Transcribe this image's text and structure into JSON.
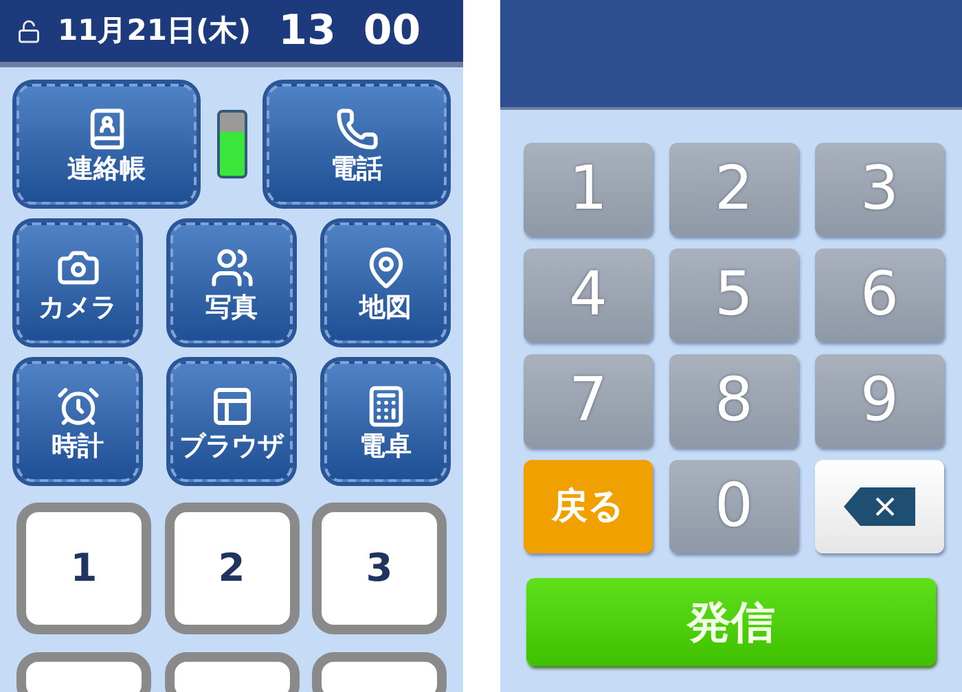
{
  "left_screen": {
    "status_bar": {
      "locked": false,
      "date": "11月21日(木)",
      "time_hours": "13",
      "time_minutes": "00"
    },
    "battery": {
      "level": 0.7
    },
    "apps": [
      {
        "label": "連絡帳"
      },
      {
        "label": "電話"
      },
      {
        "label": "カメラ"
      },
      {
        "label": "写真"
      },
      {
        "label": "地図"
      },
      {
        "label": "時計"
      },
      {
        "label": "ブラウザ"
      },
      {
        "label": "電卓"
      }
    ],
    "speed_dial": [
      "1",
      "2",
      "3"
    ]
  },
  "right_screen": {
    "keys": [
      {
        "kind": "digit",
        "label": "1"
      },
      {
        "kind": "digit",
        "label": "2"
      },
      {
        "kind": "digit",
        "label": "3"
      },
      {
        "kind": "digit",
        "label": "4"
      },
      {
        "kind": "digit",
        "label": "5"
      },
      {
        "kind": "digit",
        "label": "6"
      },
      {
        "kind": "digit",
        "label": "7"
      },
      {
        "kind": "digit",
        "label": "8"
      },
      {
        "kind": "digit",
        "label": "9"
      },
      {
        "kind": "back",
        "label": "戻る"
      },
      {
        "kind": "digit",
        "label": "0"
      },
      {
        "kind": "delete"
      }
    ],
    "call_button": "発信"
  }
}
